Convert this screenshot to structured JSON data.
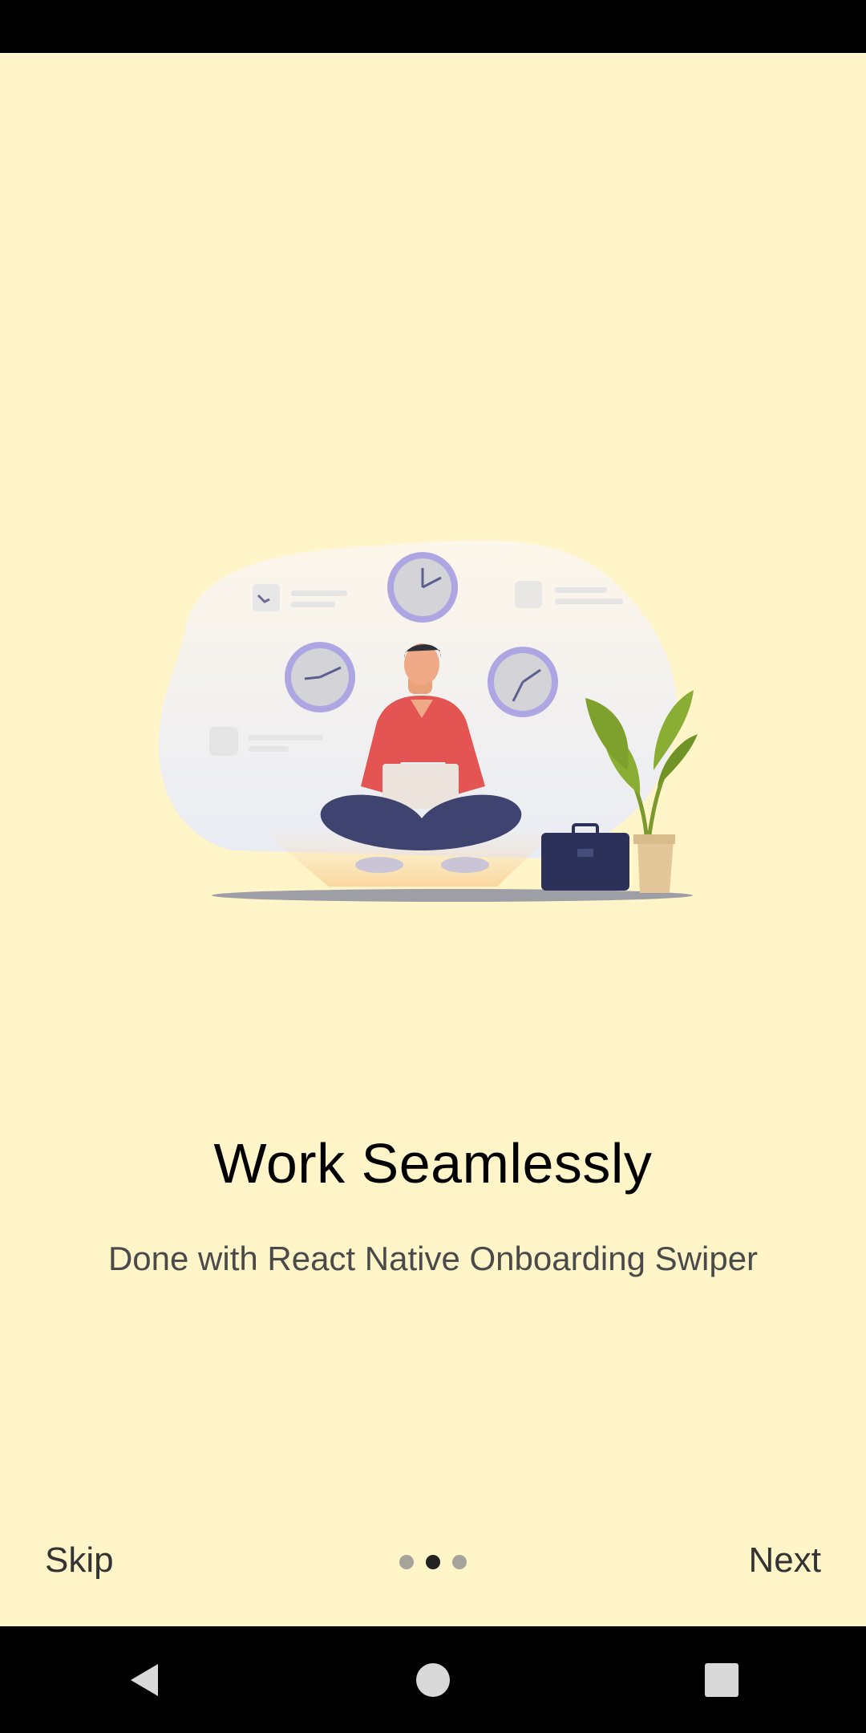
{
  "slide": {
    "title": "Work Seamlessly",
    "subtitle": "Done with React Native Onboarding Swiper"
  },
  "controls": {
    "skip_label": "Skip",
    "next_label": "Next",
    "pages_total": 3,
    "current_page": 2
  },
  "colors": {
    "background": "#fff5c9",
    "accent_shirt": "#e35452",
    "pants": "#3e4370",
    "clock_ring": "#aea6e2"
  },
  "nav_bar": {
    "back_icon": "back-triangle-icon",
    "home_icon": "home-circle-icon",
    "recents_icon": "recents-square-icon"
  }
}
